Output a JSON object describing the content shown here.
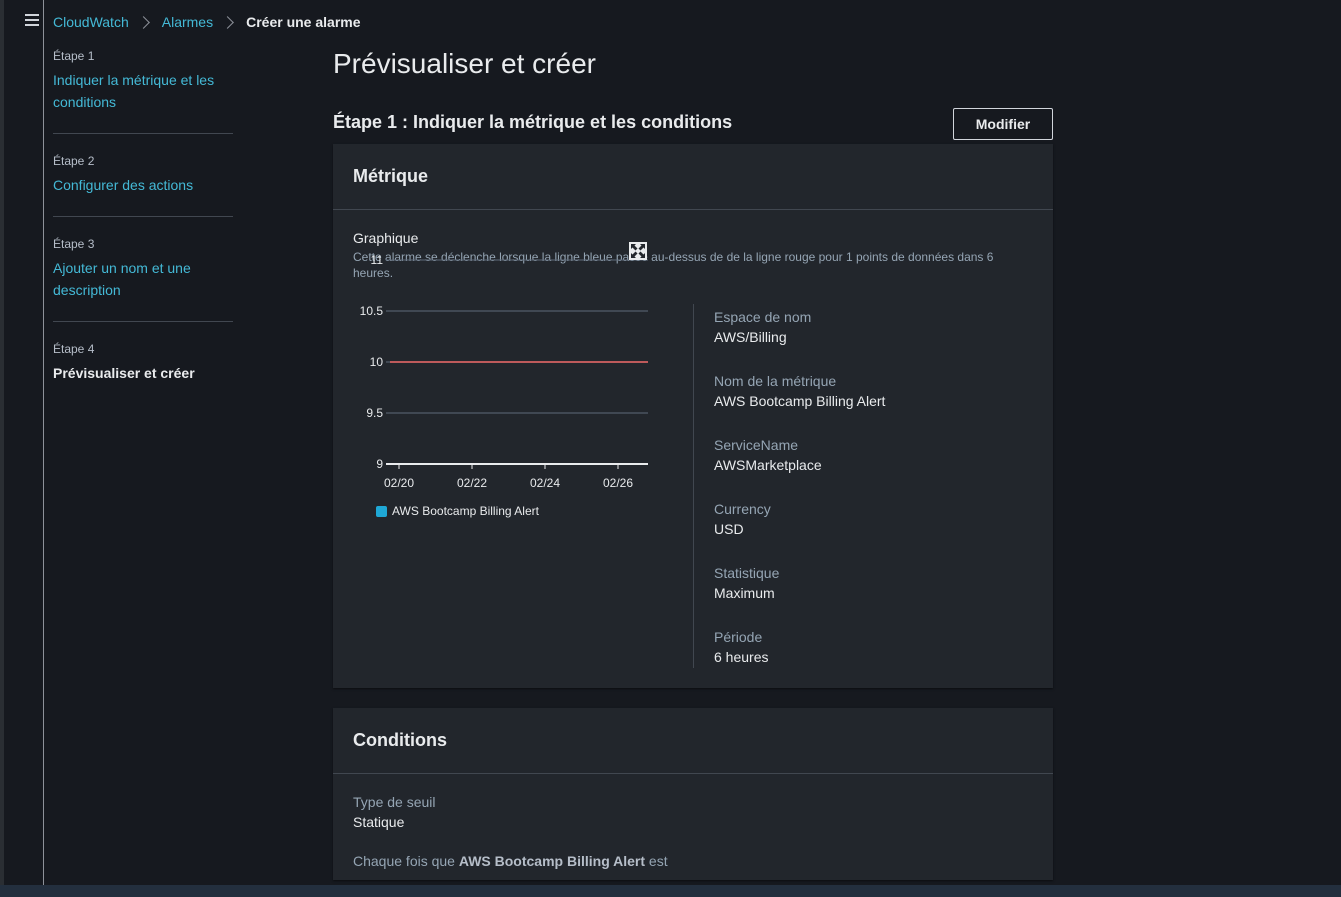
{
  "breadcrumb": {
    "items": [
      "CloudWatch",
      "Alarmes"
    ],
    "current": "Créer une alarme"
  },
  "steps": [
    {
      "num": "Étape 1",
      "label": "Indiquer la métrique et les conditions"
    },
    {
      "num": "Étape 2",
      "label": "Configurer des actions"
    },
    {
      "num": "Étape 3",
      "label": "Ajouter un nom et une description"
    },
    {
      "num": "Étape 4",
      "label": "Prévisualiser et créer"
    }
  ],
  "page": {
    "title": "Prévisualiser et créer",
    "section_title": "Étape 1 : Indiquer la métrique et les conditions",
    "modify_label": "Modifier"
  },
  "metric_card": {
    "header": "Métrique",
    "graph_label": "Graphique",
    "graph_desc": "Cette alarme se déclenche lorsque la ligne bleue passe au-dessus de de la ligne rouge pour 1 points de données dans 6 heures.",
    "properties": [
      {
        "label": "Espace de nom",
        "value": "AWS/Billing"
      },
      {
        "label": "Nom de la métrique",
        "value": "AWS Bootcamp Billing Alert"
      },
      {
        "label": "ServiceName",
        "value": "AWSMarketplace"
      },
      {
        "label": "Currency",
        "value": "USD"
      },
      {
        "label": "Statistique",
        "value": "Maximum"
      },
      {
        "label": "Période",
        "value": "6 heures"
      }
    ]
  },
  "chart_data": {
    "type": "line",
    "ylim": [
      9,
      11
    ],
    "y_ticks": [
      "11",
      "10.5",
      "10",
      "9.5",
      "9"
    ],
    "x_ticks": [
      "02/20",
      "02/22",
      "02/24",
      "02/26"
    ],
    "threshold": 10,
    "threshold_color": "#f16b6b",
    "series": [
      {
        "name": "AWS Bootcamp Billing Alert",
        "color": "#1fa8d6",
        "values": []
      }
    ],
    "grid": true,
    "legend_position": "bottom-left"
  },
  "conditions_card": {
    "header": "Conditions",
    "threshold_type_label": "Type de seuil",
    "threshold_type_value": "Statique",
    "sentence_prefix": "Chaque fois que",
    "sentence_metric": "AWS Bootcamp Billing Alert",
    "sentence_suffix": "est"
  }
}
